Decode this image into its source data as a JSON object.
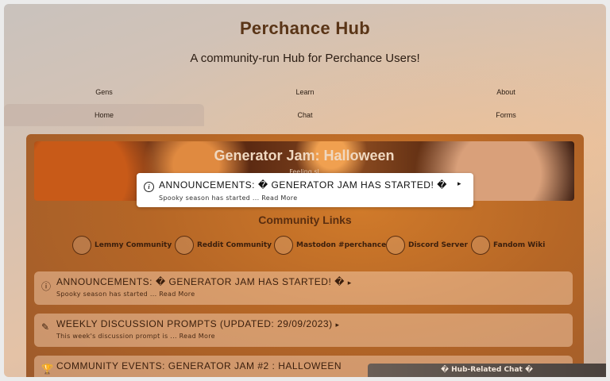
{
  "site": {
    "title": "Perchance Hub",
    "subtitle": "A community-run Hub for Perchance Users!"
  },
  "nav": {
    "row1": [
      "Gens",
      "Learn",
      "About"
    ],
    "row2": [
      "Home",
      "Chat",
      "Forms"
    ],
    "active": "Home"
  },
  "banner": {
    "title": "Generator Jam: Halloween",
    "subtitle": "Feeling sl"
  },
  "popup": {
    "icon": "info-icon",
    "title": "ANNOUNCEMENTS: � GENERATOR JAM HAS STARTED! �",
    "arrow": "▸",
    "subtitle": "Spooky season has started ... Read More"
  },
  "community": {
    "title": "Community Links",
    "links": [
      {
        "label": "Lemmy Community"
      },
      {
        "label": "Reddit Community"
      },
      {
        "label": "Mastodon #perchance"
      },
      {
        "label": "Discord Server"
      },
      {
        "label": "Fandom Wiki"
      }
    ]
  },
  "posts": [
    {
      "icon": "info-icon",
      "title": "ANNOUNCEMENTS: � GENERATOR JAM HAS STARTED! �",
      "subtitle": "Spooky season has started ... Read More",
      "arrow": "▸"
    },
    {
      "icon": "pencil-icon",
      "title": "WEEKLY DISCUSSION PROMPTS (UPDATED: 29/09/2023)",
      "subtitle": "This week's discussion prompt is ... Read More",
      "arrow": "▸"
    },
    {
      "icon": "trophy-icon",
      "title": "COMMUNITY EVENTS: GENERATOR JAM #2 : HALLOWEEN",
      "subtitle": "",
      "arrow": ""
    }
  ],
  "chat_bar": {
    "label": "� Hub-Related Chat �"
  }
}
